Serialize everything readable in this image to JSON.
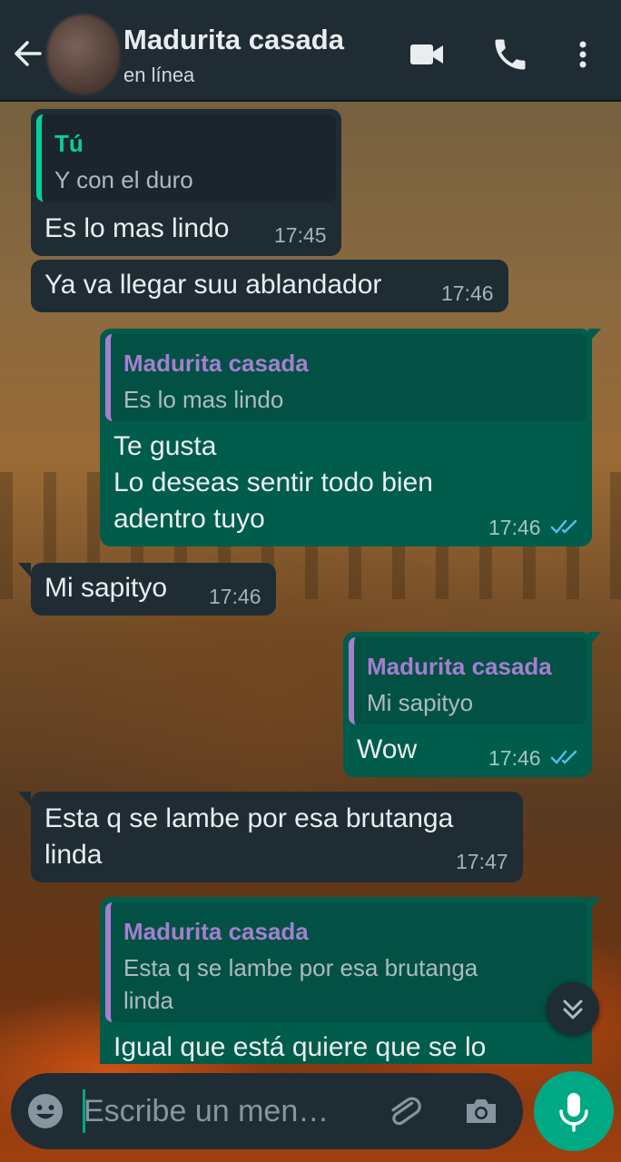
{
  "header": {
    "contact_name": "Madurita casada",
    "status": "en línea"
  },
  "messages": [
    {
      "direction": "in",
      "quote_author": "Tú",
      "quote_text": "Y con el duro",
      "text": "Es lo mas lindo",
      "time": "17:45"
    },
    {
      "direction": "in",
      "text": "Ya va llegar suu ablandador",
      "time": "17:46"
    },
    {
      "direction": "out",
      "quote_author": "Madurita casada",
      "quote_text": "Es lo mas lindo",
      "text": "Te gusta\nLo deseas sentir todo bien\nadentro tuyo",
      "time": "17:46",
      "read": true
    },
    {
      "direction": "in",
      "text": "Mi sapityo",
      "time": "17:46"
    },
    {
      "direction": "out",
      "quote_author": "Madurita casada",
      "quote_text": "Mi sapityo",
      "text": "Wow",
      "time": "17:46",
      "read": true
    },
    {
      "direction": "in",
      "text": "Esta q se lambe por esa brutanga\nlinda",
      "time": "17:47"
    },
    {
      "direction": "out",
      "quote_author": "Madurita casada",
      "quote_text": "Esta q se lambe por esa brutanga\nlinda",
      "text": "Igual que está quiere que se lo",
      "time": ""
    }
  ],
  "composer": {
    "placeholder": "Escribe un men…"
  },
  "colors": {
    "header_bg": "#1f2c34",
    "incoming_bubble": "#1f2c34",
    "outgoing_bubble": "#005c4b",
    "accent": "#00a884",
    "quote_self": "#06cf9c",
    "quote_contact": "#a67ed1",
    "read_ticks": "#53bdeb"
  },
  "icons": [
    "back-arrow-icon",
    "video-call-icon",
    "phone-icon",
    "more-vertical-icon",
    "emoji-icon",
    "paperclip-icon",
    "camera-icon",
    "microphone-icon",
    "chevron-double-down-icon"
  ]
}
